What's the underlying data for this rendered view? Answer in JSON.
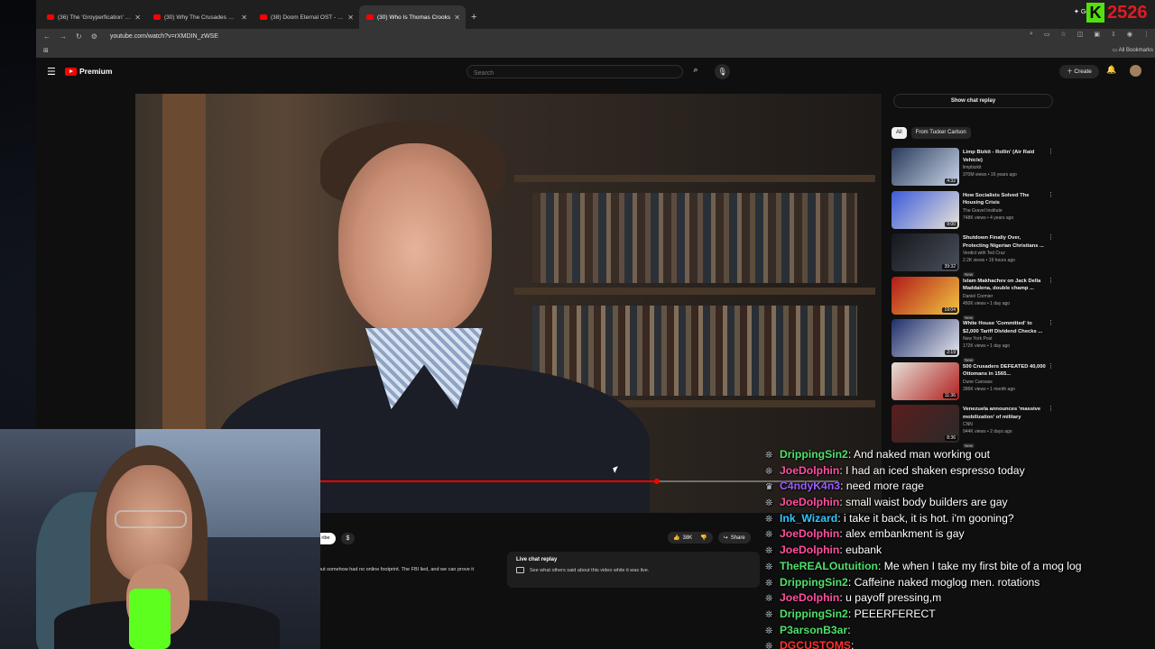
{
  "browser": {
    "tabs": [
      {
        "title": "(36) The 'Groyperfication' of th",
        "active": false
      },
      {
        "title": "(30) Why The Crusades Were A",
        "active": false
      },
      {
        "title": "(38) Doom Eternal OST - The D",
        "active": false
      },
      {
        "title": "(30) Who Is Thomas Crooks",
        "active": true
      }
    ],
    "url": "youtube.com/watch?v=rXMDIN_zWSE",
    "gemini_label": "Gemini",
    "bookmarks_label": "All Bookmarks",
    "stream_badge": {
      "letter": "K",
      "number": "2526"
    }
  },
  "youtube": {
    "logo_text": "Premium",
    "search_placeholder": "Search",
    "create_label": "Create",
    "notification_count": "9+",
    "video": {
      "progress": 0.65
    },
    "subscribe_label": "ribe",
    "like_count": "38K",
    "share_label": "Share",
    "description_snippet": "out somehow had no online footprint. The FBI lied, and we can prove it",
    "live_chat_replay": {
      "title": "Live chat replay",
      "subtitle": "See what others said about this video while it was live."
    },
    "show_chat_replay": "Show chat replay",
    "chips": [
      "All",
      "From Tucker Carlson"
    ],
    "recommendations": [
      {
        "title": "Limp Bizkit - Rollin' (Air Raid Vehicle)",
        "channel": "limpbizkit",
        "meta": "370M views • 16 years ago",
        "duration": "4:32",
        "new": false,
        "thumb": [
          "#2a3b5a",
          "#c8d4e8"
        ]
      },
      {
        "title": "How Socialists Solved The Housing Crisis",
        "channel": "The Gravel Institute",
        "meta": "748K views • 4 years ago",
        "duration": "9:00",
        "new": false,
        "thumb": [
          "#3b5bd9",
          "#e9e4d8"
        ]
      },
      {
        "title": "Shutdown Finally Over, Protecting Nigerian Christians ...",
        "channel": "Verdict with Ted Cruz",
        "meta": "2.2K views • 19 hours ago",
        "duration": "39:32",
        "new": true,
        "thumb": [
          "#15171c",
          "#4a4f5a"
        ]
      },
      {
        "title": "Islam Makhachev on Jack Della Maddalena, double champ ...",
        "channel": "Daniel Cormier",
        "meta": "450K views • 1 day ago",
        "duration": "19:04",
        "new": true,
        "thumb": [
          "#b11a1a",
          "#f2c640"
        ]
      },
      {
        "title": "White House 'Committed' to $2,000 Tariff Dividend Checks ...",
        "channel": "New York Post",
        "meta": "172K views • 1 day ago",
        "duration": "2:19",
        "new": true,
        "thumb": [
          "#1f2f6b",
          "#e7e7ee"
        ]
      },
      {
        "title": "500 Crusaders DEFEATED 40,000 Ottomans in 1565...",
        "channel": "Dune Canvass",
        "meta": "396K views • 1 month ago",
        "duration": "11:36",
        "new": false,
        "thumb": [
          "#e6e0d6",
          "#b0201f"
        ]
      },
      {
        "title": "Venezuela announces 'massive mobilization' of military",
        "channel": "CNN",
        "meta": "944K views • 2 days ago",
        "duration": "8:36",
        "new": true,
        "thumb": [
          "#5b1d1d",
          "#2a2a2a"
        ]
      }
    ]
  },
  "chat": {
    "messages": [
      {
        "user": "DrippingSin2",
        "color": "#4fe06a",
        "text": "And naked man working out",
        "badge": "❊"
      },
      {
        "user": "JoeDolphin",
        "color": "#ff4fa0",
        "text": "I had an iced shaken espresso today",
        "badge": "❊"
      },
      {
        "user": "C4ndyK4n3",
        "color": "#9c5cff",
        "text": "need more rage",
        "badge": "♛"
      },
      {
        "user": "JoeDolphin",
        "color": "#ff4fa0",
        "text": "small waist body builders are gay",
        "badge": "❊"
      },
      {
        "user": "Ink_Wizard",
        "color": "#2ec8ff",
        "text": "i take it back, it is hot. i'm gooning?",
        "badge": "❊"
      },
      {
        "user": "JoeDolphin",
        "color": "#ff4fa0",
        "text": "alex embankment is gay",
        "badge": "❊"
      },
      {
        "user": "JoeDolphin",
        "color": "#ff4fa0",
        "text": "eubank",
        "badge": "❊"
      },
      {
        "user": "TheREALOutuition",
        "color": "#4fe06a",
        "text": "Me when I take my first bite of a mog log",
        "badge": "❊"
      },
      {
        "user": "DrippingSin2",
        "color": "#4fe06a",
        "text": "Caffeine naked moglog men. rotations",
        "badge": "❊"
      },
      {
        "user": "JoeDolphin",
        "color": "#ff4fa0",
        "text": "u payoff pressing,m",
        "badge": "❊"
      },
      {
        "user": "DrippingSin2",
        "color": "#4fe06a",
        "text": "PEEERFERECT",
        "badge": "❊"
      },
      {
        "user": "P3arsonB3ar",
        "color": "#4fe06a",
        "text": "",
        "badge": "❊"
      },
      {
        "user": "DGCUSTOMS",
        "color": "#ff3030",
        "text": "",
        "badge": "❊"
      }
    ]
  }
}
